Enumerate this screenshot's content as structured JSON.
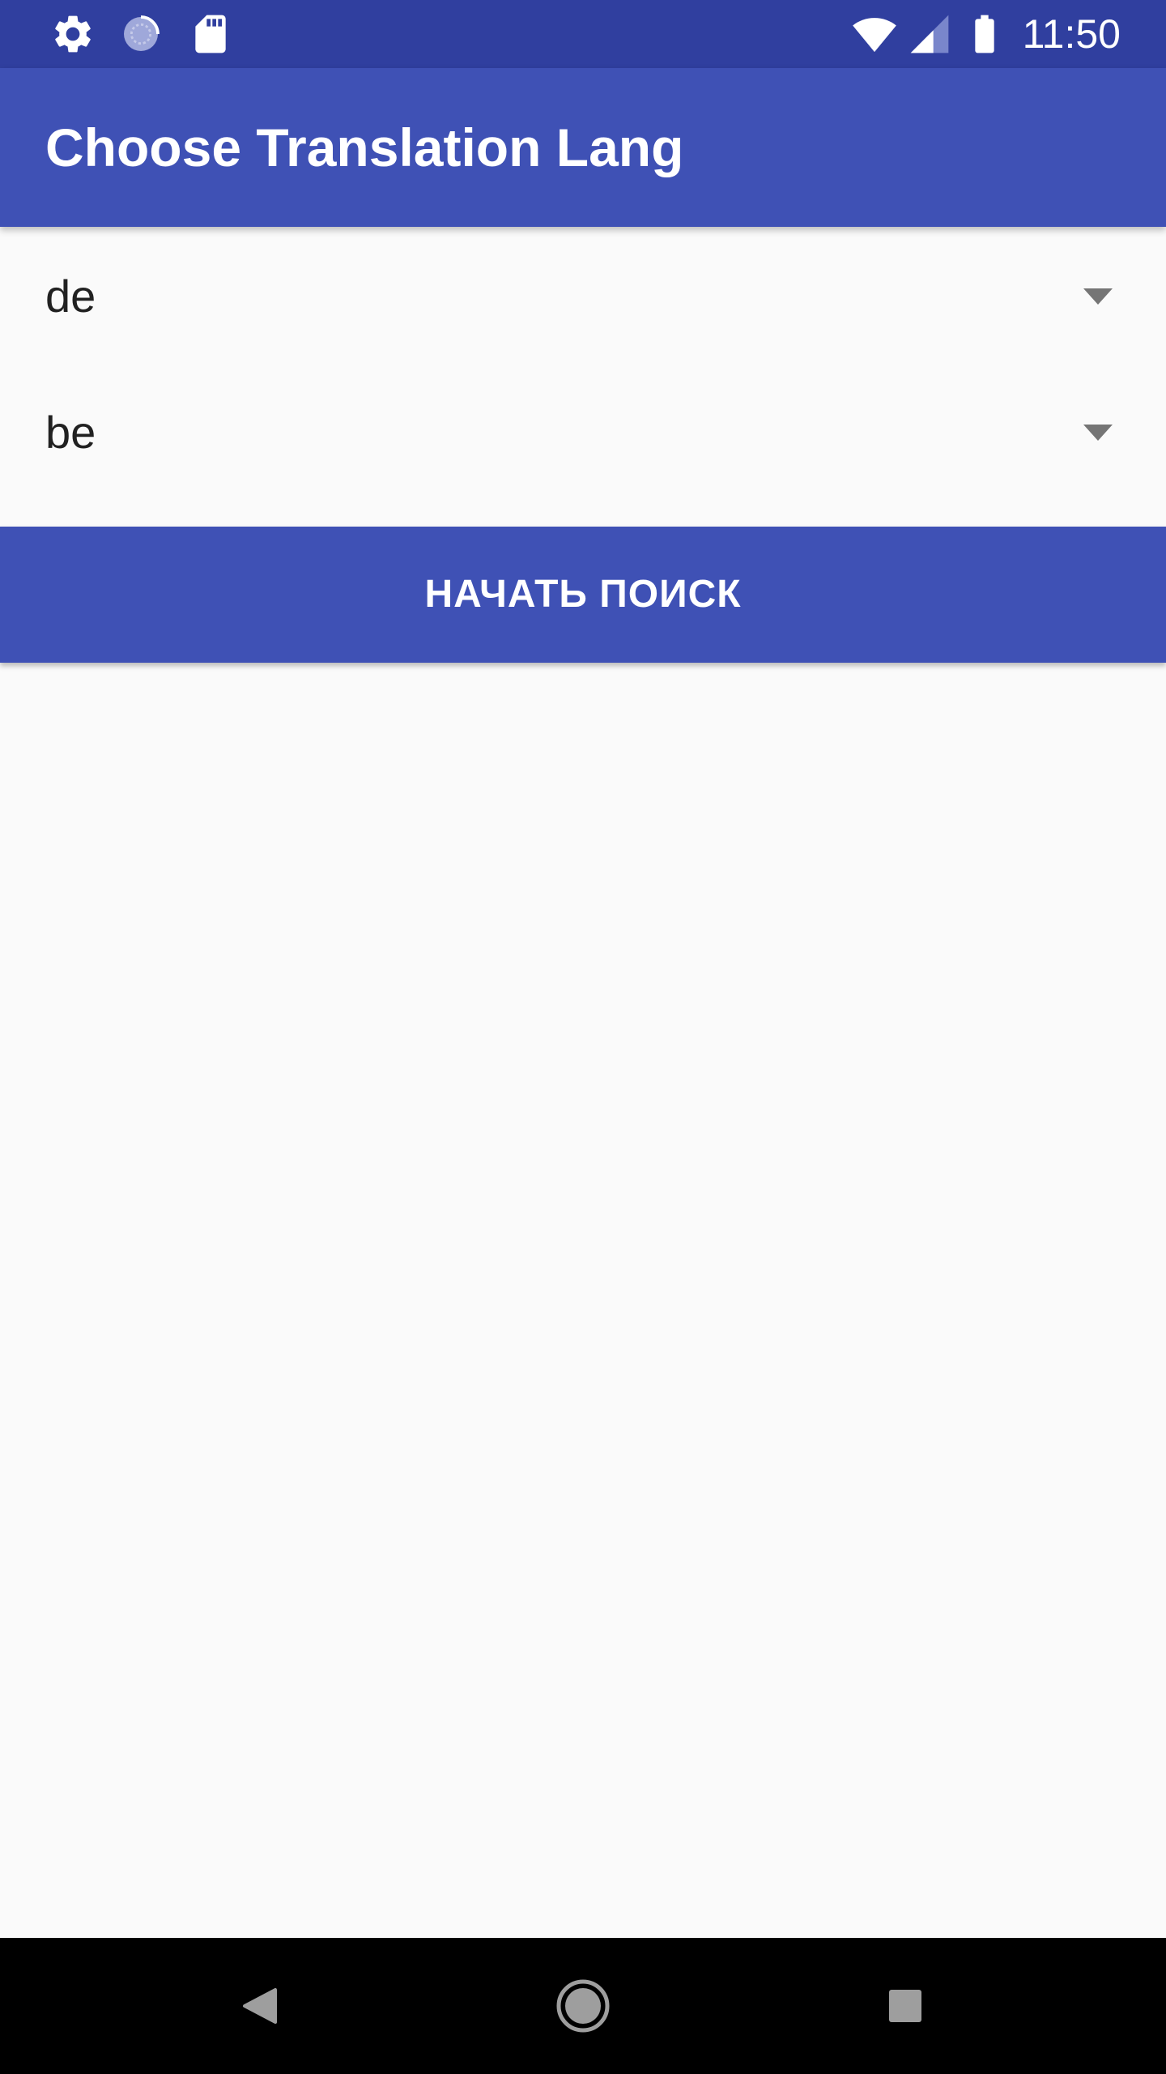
{
  "status_bar": {
    "time": "11:50",
    "left_icons": [
      "gear-icon",
      "loading-icon",
      "sd-card-icon"
    ],
    "right_icons": [
      "wifi-icon",
      "cell-signal-icon",
      "battery-icon"
    ]
  },
  "app_bar": {
    "title": "Choose Translation Lang"
  },
  "spinners": {
    "source_lang": {
      "selected": "de"
    },
    "target_lang": {
      "selected": "be"
    }
  },
  "search_button": {
    "label": "НАЧАТЬ ПОИСК"
  },
  "nav_bar": {
    "buttons": [
      "back-icon",
      "home-icon",
      "recents-icon"
    ]
  },
  "colors": {
    "status_bar": "#303f9f",
    "primary": "#3f51b5",
    "background": "#fafafa",
    "text": "#212121",
    "spinner_arrow": "#757575",
    "nav_bar": "#000000"
  }
}
